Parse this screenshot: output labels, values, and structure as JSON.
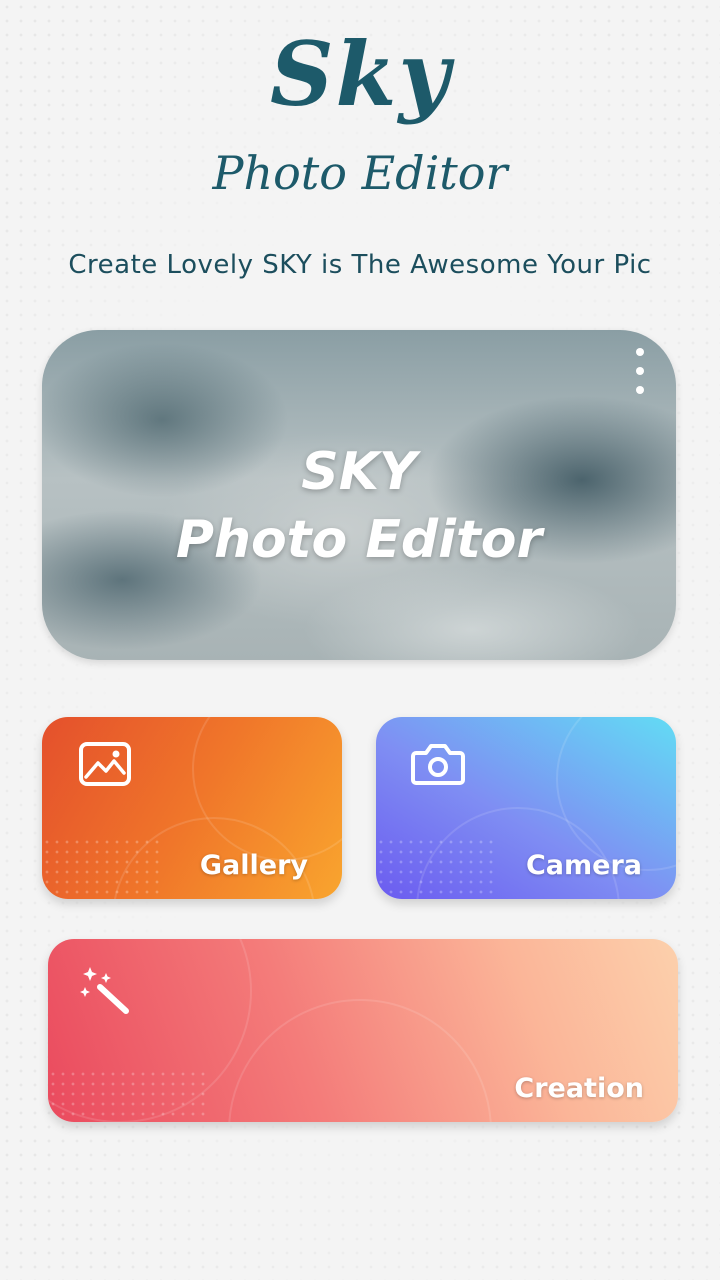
{
  "logo": {
    "sky": "Sky",
    "photo_editor": "Photo Editor",
    "color": "#1d5a6a"
  },
  "tagline": "Create Lovely SKY is The Awesome Your Pic",
  "hero": {
    "line1": "SKY",
    "line2": "Photo Editor",
    "menu_icon": "more-vert-icon"
  },
  "actions": {
    "gallery": {
      "label": "Gallery",
      "icon": "image-icon",
      "colors": [
        "#e4502c",
        "#f9a52e"
      ]
    },
    "camera": {
      "label": "Camera",
      "icon": "camera-icon",
      "colors": [
        "#6b5bf0",
        "#62dcf4"
      ]
    },
    "creation": {
      "label": "Creation",
      "icon": "magic-wand-icon",
      "colors": [
        "#ea4a5e",
        "#fcd0ac"
      ]
    }
  }
}
